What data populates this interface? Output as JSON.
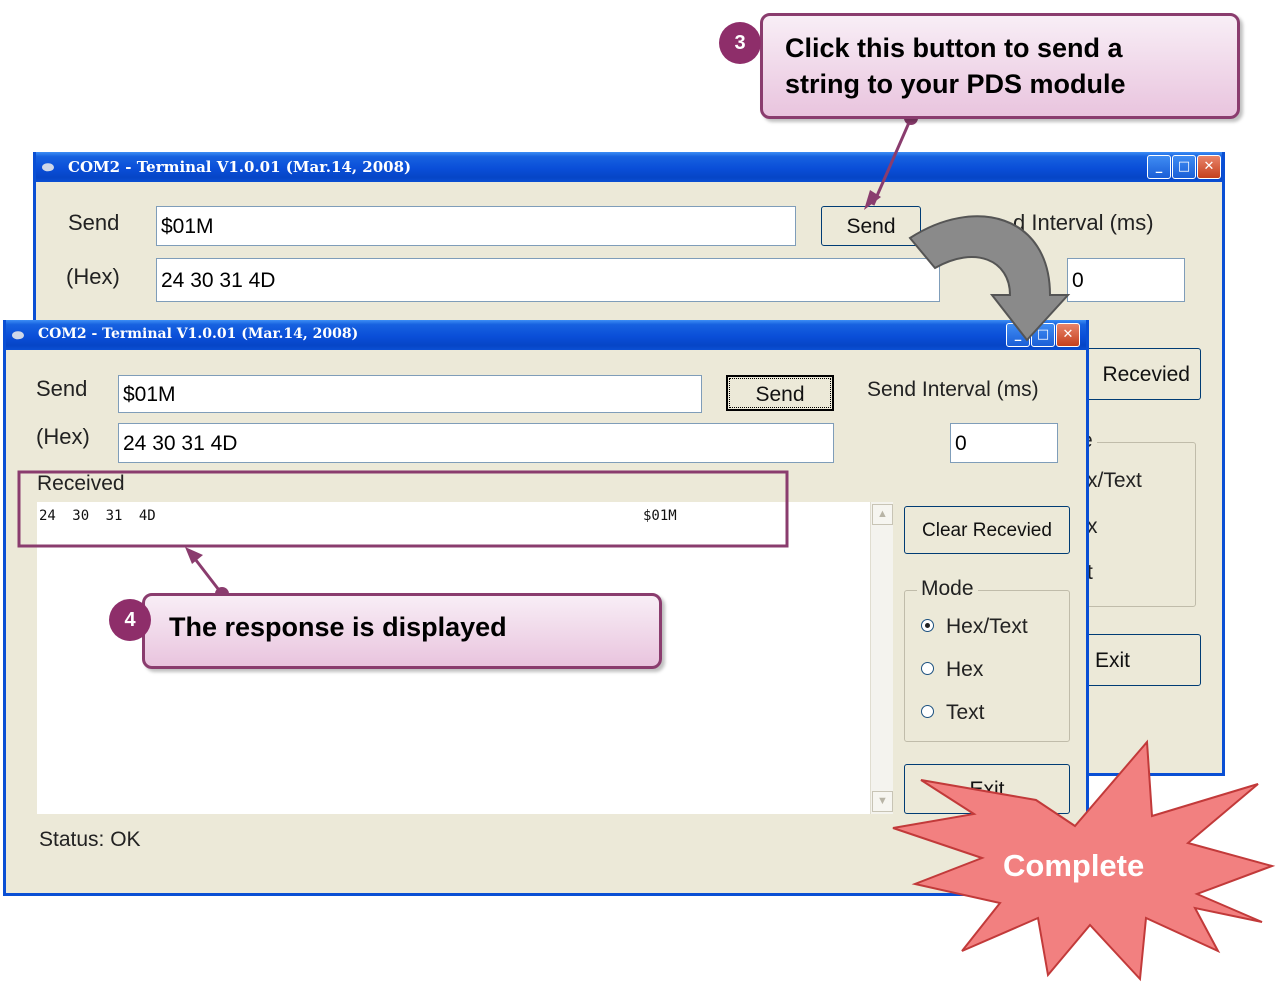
{
  "window_title": "COM2 - Terminal V1.0.01 (Mar.14, 2008)",
  "title_buttons": {
    "minimize": "_",
    "maximize": "□",
    "close": "✕"
  },
  "back_window": {
    "send_label": "Send",
    "send_value": "$01M",
    "hex_label": "(Hex)",
    "hex_value": "24 30 31 4D",
    "send_button": "Send",
    "interval_label": "d Interval (ms)",
    "interval_value": "0",
    "clear_button": "Recevied",
    "mode_title": "e",
    "mode_options": [
      "x/Text",
      "x",
      "t"
    ],
    "exit_button": "Exit"
  },
  "front_window": {
    "send_label": "Send",
    "send_value": "$01M",
    "hex_label": "(Hex)",
    "hex_value": "24 30 31 4D",
    "send_button": "Send",
    "interval_label": "Send Interval (ms)",
    "interval_value": "0",
    "received_label": "Received",
    "received_hex": "24 30 31 4D",
    "received_text": "$01M",
    "clear_button": "Clear Recevied",
    "mode_title": "Mode",
    "mode_options": [
      "Hex/Text",
      "Hex",
      "Text"
    ],
    "mode_selected": "Hex/Text",
    "exit_button": "Exit",
    "status": "Status: OK"
  },
  "callouts": {
    "step3_number": "3",
    "step3_text": "Click this button to send a string to your PDS module",
    "step4_number": "4",
    "step4_text": "The response is displayed",
    "complete": "Complete"
  },
  "colors": {
    "accent": "#8e2e6a",
    "titlebar": "#0a4fd4",
    "star_fill": "#f28080",
    "star_stroke": "#c23a3a",
    "window_bg": "#ece9d8"
  }
}
